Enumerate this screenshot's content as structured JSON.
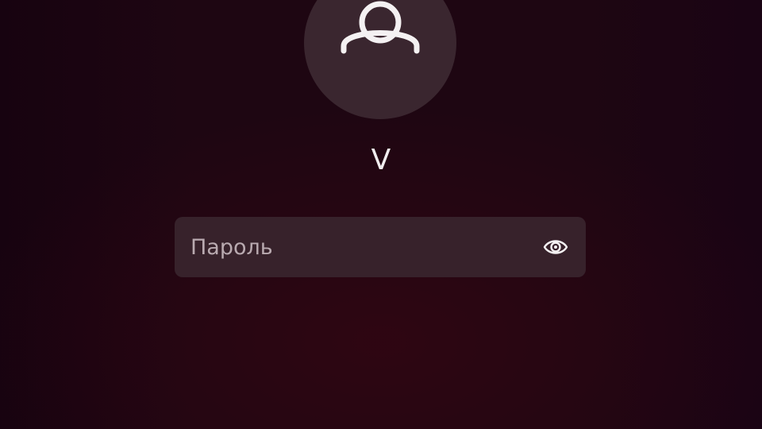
{
  "user": {
    "avatar_icon": "user-avatar-icon",
    "name": "V"
  },
  "password": {
    "placeholder": "Пароль",
    "value": "",
    "reveal_icon": "eye-icon"
  },
  "colors": {
    "background": "#1e0612",
    "avatar_background": "#3a262f",
    "field_background": "#37222b",
    "text": "#f0ecee",
    "placeholder": "#b9aab0"
  }
}
